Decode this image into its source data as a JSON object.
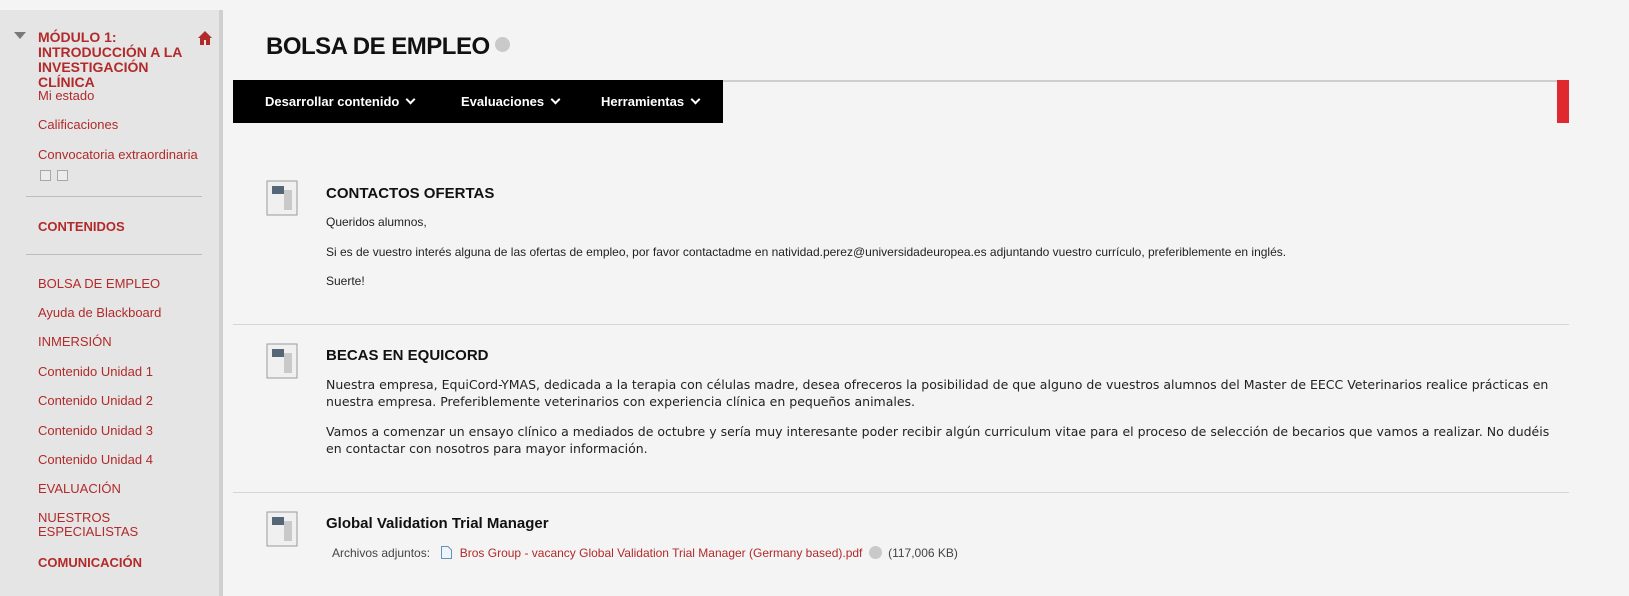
{
  "sidebar": {
    "course_title": "MÓDULO 1: INTRODUCCIÓN A LA INVESTIGACIÓN CLÍNICA",
    "top_links": [
      "Mi estado",
      "Calificaciones",
      "Convocatoria extraordinaria"
    ],
    "section_label": "CONTENIDOS",
    "links": [
      "BOLSA DE EMPLEO",
      "Ayuda de Blackboard",
      "INMERSIÓN",
      "Contenido Unidad 1",
      "Contenido Unidad 2",
      "Contenido Unidad 3",
      "Contenido Unidad 4",
      "EVALUACIÓN",
      "NUESTROS ESPECIALISTAS"
    ],
    "bottom_section": "COMUNICACIÓN"
  },
  "page": {
    "title": "BOLSA DE EMPLEO"
  },
  "toolbar": {
    "items": [
      "Desarrollar contenido",
      "Evaluaciones",
      "Herramientas"
    ]
  },
  "items": [
    {
      "title": "CONTACTOS OFERTAS",
      "paragraphs": [
        "Queridos alumnos,",
        "Si es de vuestro interés alguna de las ofertas de empleo, por favor contactadme en natividad.perez@universidadeuropea.es adjuntando vuestro currículo, preferiblemente en inglés.",
        "Suerte!"
      ]
    },
    {
      "title": "BECAS EN EQUICORD",
      "paragraphs": [
        "Nuestra  empresa, EquiCord-YMAS, dedicada a la terapia con células madre, desea ofreceros la posibilidad de que alguno de vuestros alumnos del Master de EECC Veterinarios realice prácticas en nuestra empresa. Preferiblemente veterinarios con experiencia clínica en pequeños animales.",
        "Vamos a comenzar un ensayo clínico a mediados de octubre y sería muy interesante poder recibir algún curriculum vitae para el proceso de selección de becarios que vamos a realizar. No dudéis en contactar con nosotros para mayor información."
      ]
    },
    {
      "title": "Global Validation Trial Manager",
      "attachments_label": "Archivos adjuntos:",
      "attachment_name": "Bros Group - vacancy Global Validation Trial Manager (Germany based).pdf",
      "attachment_size": "(117,006 KB)"
    }
  ],
  "colors": {
    "link": "#b22a2a",
    "toolbar": "#000000",
    "accent": "#e0282f"
  },
  "icons": [
    "chevron-down-icon",
    "home-icon",
    "document-icon",
    "file-icon",
    "edit-icon"
  ]
}
